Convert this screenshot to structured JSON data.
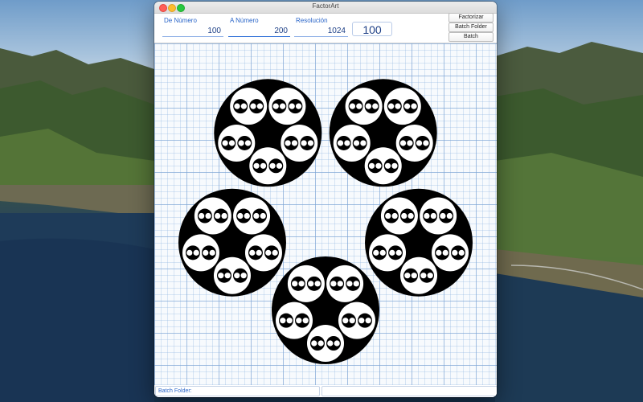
{
  "window": {
    "title": "FactorArt"
  },
  "inputs": {
    "from": {
      "label": "De Número",
      "value": "100"
    },
    "to": {
      "label": "A Número",
      "value": "200"
    },
    "resolution": {
      "label": "Resolución",
      "value": "1024"
    }
  },
  "current_value": "100",
  "buttons": {
    "factorize": "Factorizar",
    "batch_folder": "Batch Folder",
    "batch": "Batch"
  },
  "status": {
    "batch_folder_label": "Batch Folder:",
    "message": ""
  },
  "colors": {
    "accent": "#2a65c8",
    "art_black": "#000000",
    "art_white": "#ffffff"
  },
  "art": {
    "factorization": [
      5,
      5,
      2,
      2
    ],
    "description": ""
  }
}
